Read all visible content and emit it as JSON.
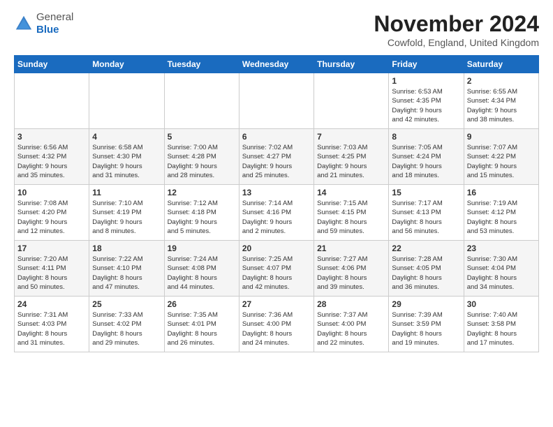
{
  "header": {
    "logo_general": "General",
    "logo_blue": "Blue",
    "month": "November 2024",
    "location": "Cowfold, England, United Kingdom"
  },
  "days_of_week": [
    "Sunday",
    "Monday",
    "Tuesday",
    "Wednesday",
    "Thursday",
    "Friday",
    "Saturday"
  ],
  "weeks": [
    [
      {
        "day": "",
        "info": ""
      },
      {
        "day": "",
        "info": ""
      },
      {
        "day": "",
        "info": ""
      },
      {
        "day": "",
        "info": ""
      },
      {
        "day": "",
        "info": ""
      },
      {
        "day": "1",
        "info": "Sunrise: 6:53 AM\nSunset: 4:35 PM\nDaylight: 9 hours\nand 42 minutes."
      },
      {
        "day": "2",
        "info": "Sunrise: 6:55 AM\nSunset: 4:34 PM\nDaylight: 9 hours\nand 38 minutes."
      }
    ],
    [
      {
        "day": "3",
        "info": "Sunrise: 6:56 AM\nSunset: 4:32 PM\nDaylight: 9 hours\nand 35 minutes."
      },
      {
        "day": "4",
        "info": "Sunrise: 6:58 AM\nSunset: 4:30 PM\nDaylight: 9 hours\nand 31 minutes."
      },
      {
        "day": "5",
        "info": "Sunrise: 7:00 AM\nSunset: 4:28 PM\nDaylight: 9 hours\nand 28 minutes."
      },
      {
        "day": "6",
        "info": "Sunrise: 7:02 AM\nSunset: 4:27 PM\nDaylight: 9 hours\nand 25 minutes."
      },
      {
        "day": "7",
        "info": "Sunrise: 7:03 AM\nSunset: 4:25 PM\nDaylight: 9 hours\nand 21 minutes."
      },
      {
        "day": "8",
        "info": "Sunrise: 7:05 AM\nSunset: 4:24 PM\nDaylight: 9 hours\nand 18 minutes."
      },
      {
        "day": "9",
        "info": "Sunrise: 7:07 AM\nSunset: 4:22 PM\nDaylight: 9 hours\nand 15 minutes."
      }
    ],
    [
      {
        "day": "10",
        "info": "Sunrise: 7:08 AM\nSunset: 4:20 PM\nDaylight: 9 hours\nand 12 minutes."
      },
      {
        "day": "11",
        "info": "Sunrise: 7:10 AM\nSunset: 4:19 PM\nDaylight: 9 hours\nand 8 minutes."
      },
      {
        "day": "12",
        "info": "Sunrise: 7:12 AM\nSunset: 4:18 PM\nDaylight: 9 hours\nand 5 minutes."
      },
      {
        "day": "13",
        "info": "Sunrise: 7:14 AM\nSunset: 4:16 PM\nDaylight: 9 hours\nand 2 minutes."
      },
      {
        "day": "14",
        "info": "Sunrise: 7:15 AM\nSunset: 4:15 PM\nDaylight: 8 hours\nand 59 minutes."
      },
      {
        "day": "15",
        "info": "Sunrise: 7:17 AM\nSunset: 4:13 PM\nDaylight: 8 hours\nand 56 minutes."
      },
      {
        "day": "16",
        "info": "Sunrise: 7:19 AM\nSunset: 4:12 PM\nDaylight: 8 hours\nand 53 minutes."
      }
    ],
    [
      {
        "day": "17",
        "info": "Sunrise: 7:20 AM\nSunset: 4:11 PM\nDaylight: 8 hours\nand 50 minutes."
      },
      {
        "day": "18",
        "info": "Sunrise: 7:22 AM\nSunset: 4:10 PM\nDaylight: 8 hours\nand 47 minutes."
      },
      {
        "day": "19",
        "info": "Sunrise: 7:24 AM\nSunset: 4:08 PM\nDaylight: 8 hours\nand 44 minutes."
      },
      {
        "day": "20",
        "info": "Sunrise: 7:25 AM\nSunset: 4:07 PM\nDaylight: 8 hours\nand 42 minutes."
      },
      {
        "day": "21",
        "info": "Sunrise: 7:27 AM\nSunset: 4:06 PM\nDaylight: 8 hours\nand 39 minutes."
      },
      {
        "day": "22",
        "info": "Sunrise: 7:28 AM\nSunset: 4:05 PM\nDaylight: 8 hours\nand 36 minutes."
      },
      {
        "day": "23",
        "info": "Sunrise: 7:30 AM\nSunset: 4:04 PM\nDaylight: 8 hours\nand 34 minutes."
      }
    ],
    [
      {
        "day": "24",
        "info": "Sunrise: 7:31 AM\nSunset: 4:03 PM\nDaylight: 8 hours\nand 31 minutes."
      },
      {
        "day": "25",
        "info": "Sunrise: 7:33 AM\nSunset: 4:02 PM\nDaylight: 8 hours\nand 29 minutes."
      },
      {
        "day": "26",
        "info": "Sunrise: 7:35 AM\nSunset: 4:01 PM\nDaylight: 8 hours\nand 26 minutes."
      },
      {
        "day": "27",
        "info": "Sunrise: 7:36 AM\nSunset: 4:00 PM\nDaylight: 8 hours\nand 24 minutes."
      },
      {
        "day": "28",
        "info": "Sunrise: 7:37 AM\nSunset: 4:00 PM\nDaylight: 8 hours\nand 22 minutes."
      },
      {
        "day": "29",
        "info": "Sunrise: 7:39 AM\nSunset: 3:59 PM\nDaylight: 8 hours\nand 19 minutes."
      },
      {
        "day": "30",
        "info": "Sunrise: 7:40 AM\nSunset: 3:58 PM\nDaylight: 8 hours\nand 17 minutes."
      }
    ]
  ]
}
